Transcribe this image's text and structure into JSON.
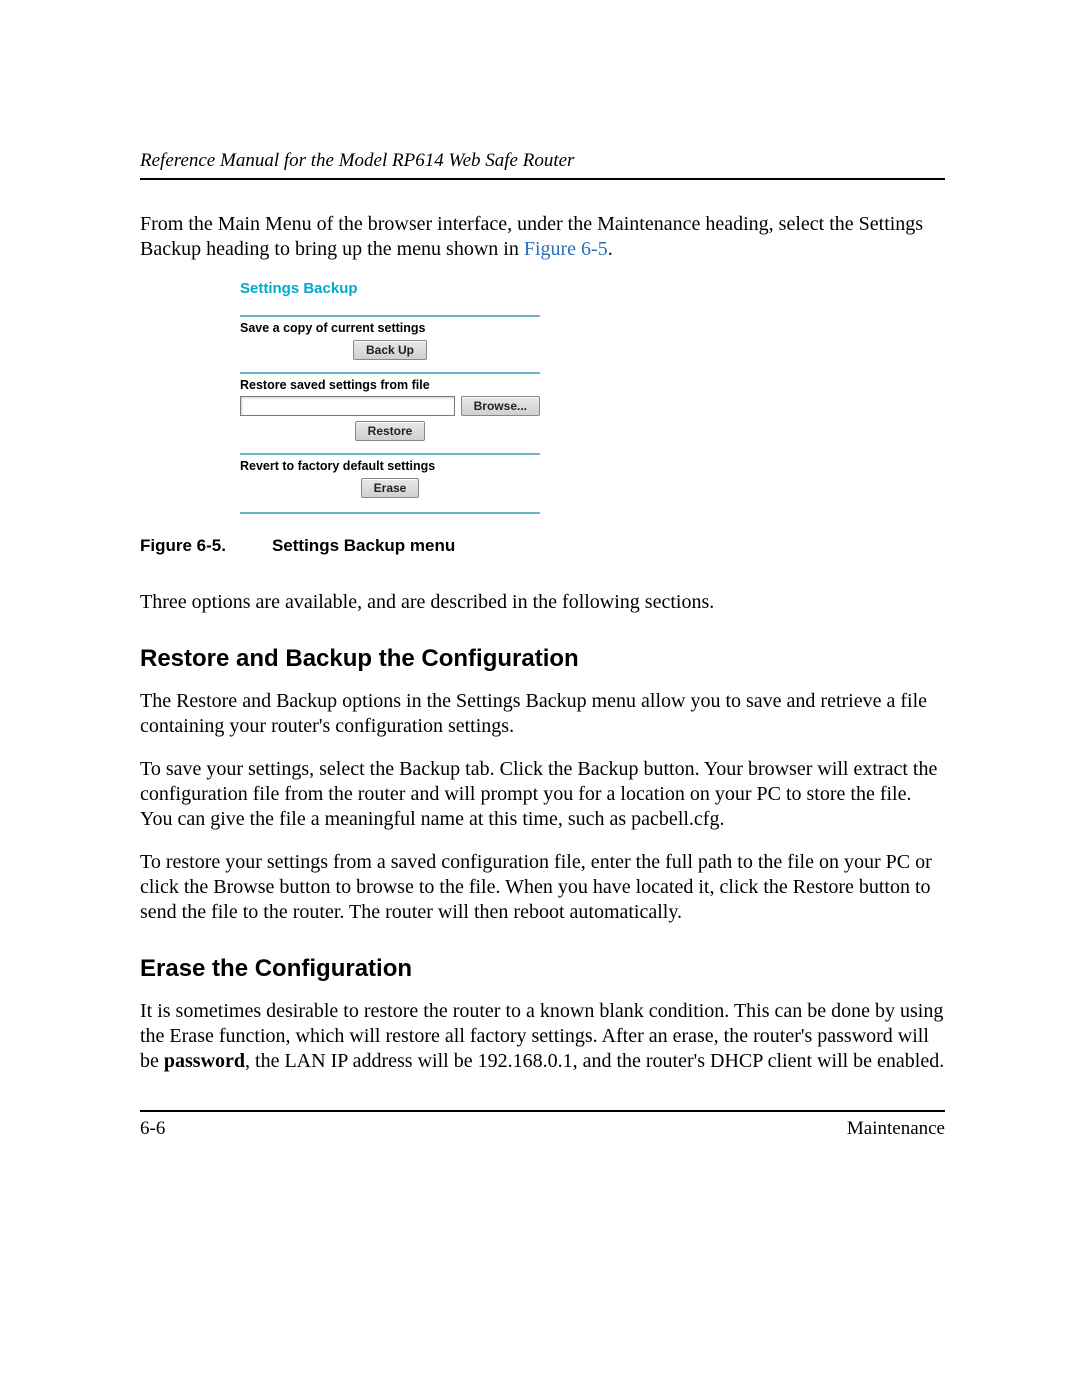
{
  "header": {
    "running_head": "Reference Manual for the Model RP614 Web Safe Router"
  },
  "intro": {
    "p1_a": "From the Main Menu of the browser interface, under the Maintenance heading, select the Settings Backup heading to bring up the menu shown in ",
    "fig_link": "Figure 6-5",
    "p1_b": "."
  },
  "screenshot": {
    "title": "Settings Backup",
    "section1_label": "Save a copy of current settings",
    "backup_btn": "Back Up",
    "section2_label": "Restore saved settings from file",
    "file_value": "",
    "browse_btn": "Browse...",
    "restore_btn": "Restore",
    "section3_label": "Revert to factory default settings",
    "erase_btn": "Erase"
  },
  "figure_caption": {
    "label": "Figure 6-5.",
    "text": "Settings Backup menu"
  },
  "after_figure": {
    "p": "Three options are available, and are described in the following sections."
  },
  "sec1": {
    "heading": "Restore and Backup the Configuration",
    "p1": "The Restore and Backup options in the Settings Backup menu allow you to save and retrieve a file containing your router's configuration settings.",
    "p2": "To save your settings, select the Backup tab. Click the Backup button. Your browser will extract the configuration file from the router and will prompt you for a location on your PC to store the file. You can give the file a meaningful name at this time, such as pacbell.cfg.",
    "p3": "To restore your settings from a saved configuration file, enter the full path to the file on your PC or click the Browse button to browse to the file. When you have located it, click the Restore button to send the file to the router. The router will then reboot automatically."
  },
  "sec2": {
    "heading": "Erase the Configuration",
    "p1_a": "It is sometimes desirable to restore the router to a known blank condition. This can be done by using the Erase function, which will restore all factory settings. After an erase, the router's password will be ",
    "p1_bold": "password",
    "p1_b": ", the LAN IP address will be 192.168.0.1, and the router's DHCP client will be enabled."
  },
  "footer": {
    "page_num": "6-6",
    "section": "Maintenance"
  }
}
